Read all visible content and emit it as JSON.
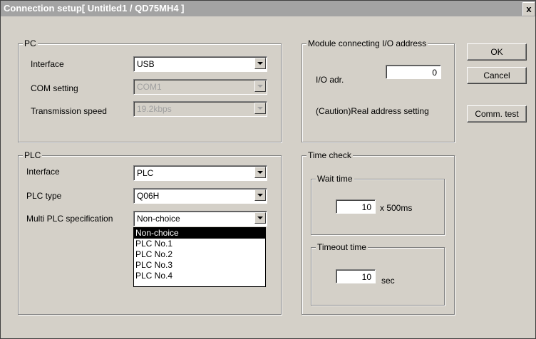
{
  "window": {
    "title": "Connection setup[ Untitled1 / QD75MH4 ]",
    "close_label": "x"
  },
  "pc": {
    "legend": "PC",
    "interface_label": "Interface",
    "interface_value": "USB",
    "com_label": "COM setting",
    "com_value": "COM1",
    "speed_label": "Transmission speed",
    "speed_value": "19.2kbps"
  },
  "module": {
    "legend": "Module connecting I/O address",
    "io_label": "I/O adr.",
    "io_value": "0",
    "caution": "(Caution)Real address setting"
  },
  "buttons": {
    "ok": "OK",
    "cancel": "Cancel",
    "comm_test": "Comm. test"
  },
  "plc": {
    "legend": "PLC",
    "interface_label": "Interface",
    "interface_value": "PLC",
    "type_label": "PLC type",
    "type_value": "Q06H",
    "multi_label": "Multi PLC specification",
    "multi_value": "Non-choice",
    "multi_options": [
      "Non-choice",
      "PLC No.1",
      "PLC No.2",
      "PLC No.3",
      "PLC No.4"
    ],
    "multi_selected_index": 0
  },
  "time_check": {
    "legend": "Time check",
    "wait_legend": "Wait time",
    "wait_value": "10",
    "wait_unit": "x 500ms",
    "timeout_legend": "Timeout time",
    "timeout_value": "10",
    "timeout_unit": "sec"
  }
}
